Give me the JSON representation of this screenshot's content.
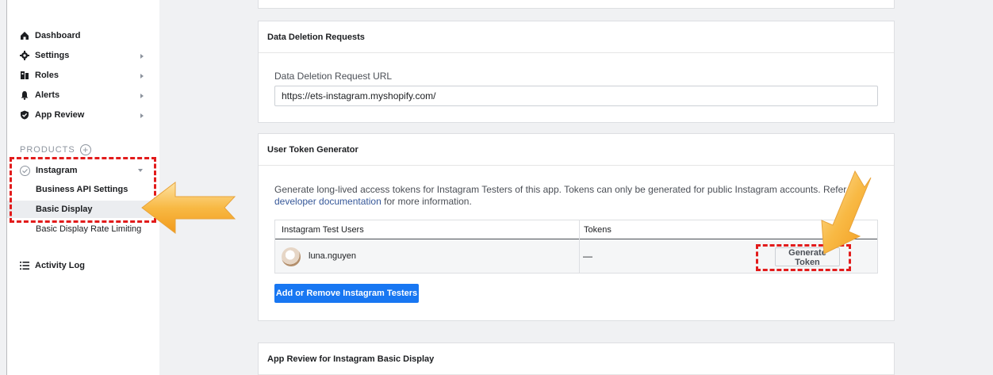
{
  "sidebar": {
    "nav": [
      {
        "label": "Dashboard",
        "icon": "home-icon"
      },
      {
        "label": "Settings",
        "icon": "gear-icon"
      },
      {
        "label": "Roles",
        "icon": "roles-icon"
      },
      {
        "label": "Alerts",
        "icon": "bell-icon"
      },
      {
        "label": "App Review",
        "icon": "shield-check-icon"
      }
    ],
    "products_label": "PRODUCTS",
    "product": {
      "label": "Instagram",
      "subitems": [
        "Business API Settings",
        "Basic Display",
        "Basic Display Rate Limiting"
      ]
    },
    "activity_log": "Activity Log"
  },
  "data_deletion": {
    "title": "Data Deletion Requests",
    "field_label": "Data Deletion Request URL",
    "field_value": "https://ets-instagram.myshopify.com/"
  },
  "token_generator": {
    "title": "User Token Generator",
    "desc_part1": "Generate long-lived access tokens for Instagram Testers of this app. Tokens can only be generated for public Instagram accounts. Refer",
    "desc_part1b": "r",
    "desc_link": "developer documentation",
    "desc_part2": "for more information.",
    "table": {
      "columns": [
        "Instagram Test Users",
        "Tokens"
      ],
      "rows": [
        {
          "user": "luna.nguyen",
          "token": "—",
          "action": "Generate Token"
        }
      ]
    },
    "add_button": "Add or Remove Instagram Testers"
  },
  "app_review": {
    "title": "App Review for Instagram Basic Display"
  },
  "colors": {
    "accent": "#1877f2",
    "highlight": "#e21b1b",
    "arrow": "#f5a623"
  }
}
